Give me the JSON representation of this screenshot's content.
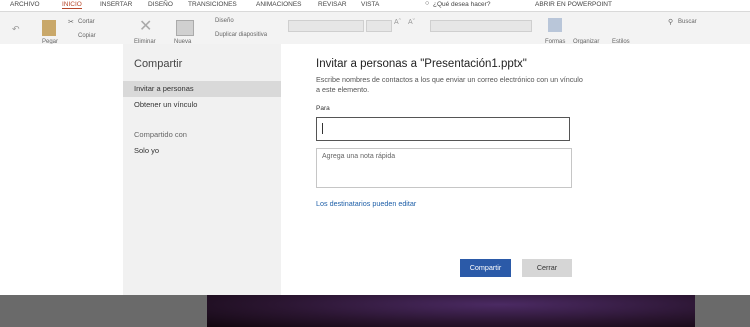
{
  "tabs": [
    {
      "label": "ARCHIVO",
      "active": false
    },
    {
      "label": "INICIO",
      "active": true
    },
    {
      "label": "INSERTAR",
      "active": false
    },
    {
      "label": "DISEÑO",
      "active": false
    },
    {
      "label": "TRANSICIONES",
      "active": false
    },
    {
      "label": "ANIMACIONES",
      "active": false
    },
    {
      "label": "REVISAR",
      "active": false
    },
    {
      "label": "VISTA",
      "active": false
    }
  ],
  "tell_me": "¿Qué desea hacer?",
  "open_in_app": "ABRIR EN POWERPOINT",
  "ribbon": {
    "paste": "Pegar",
    "cut": "Cortar",
    "copy": "Copiar",
    "delete": "Eliminar",
    "new": "Nueva",
    "layout": "Diseño",
    "duplicate": "Duplicar diapositiva",
    "shapes": "Formas",
    "arrange": "Organizar",
    "styles": "Estilos",
    "search": "Buscar"
  },
  "dialog": {
    "sidebar_title": "Compartir",
    "nav": [
      {
        "label": "Invitar a personas",
        "selected": true
      },
      {
        "label": "Obtener un vínculo",
        "selected": false
      }
    ],
    "shared_with_label": "Compartido con",
    "shared_with_value": "Solo yo",
    "title": "Invitar a personas a \"Presentación1.pptx\"",
    "description": "Escribe nombres de contactos a los que enviar un correo electrónico con un vínculo a este elemento.",
    "to_label": "Para",
    "to_value": "",
    "note_placeholder": "Agrega una nota rápida",
    "permission_link": "Los destinatarios pueden editar",
    "share_button": "Compartir",
    "cancel_button": "Cerrar"
  },
  "colors": {
    "accent_tab": "#b7472a",
    "primary_button": "#2b5aa8",
    "link": "#1e5fa8"
  }
}
